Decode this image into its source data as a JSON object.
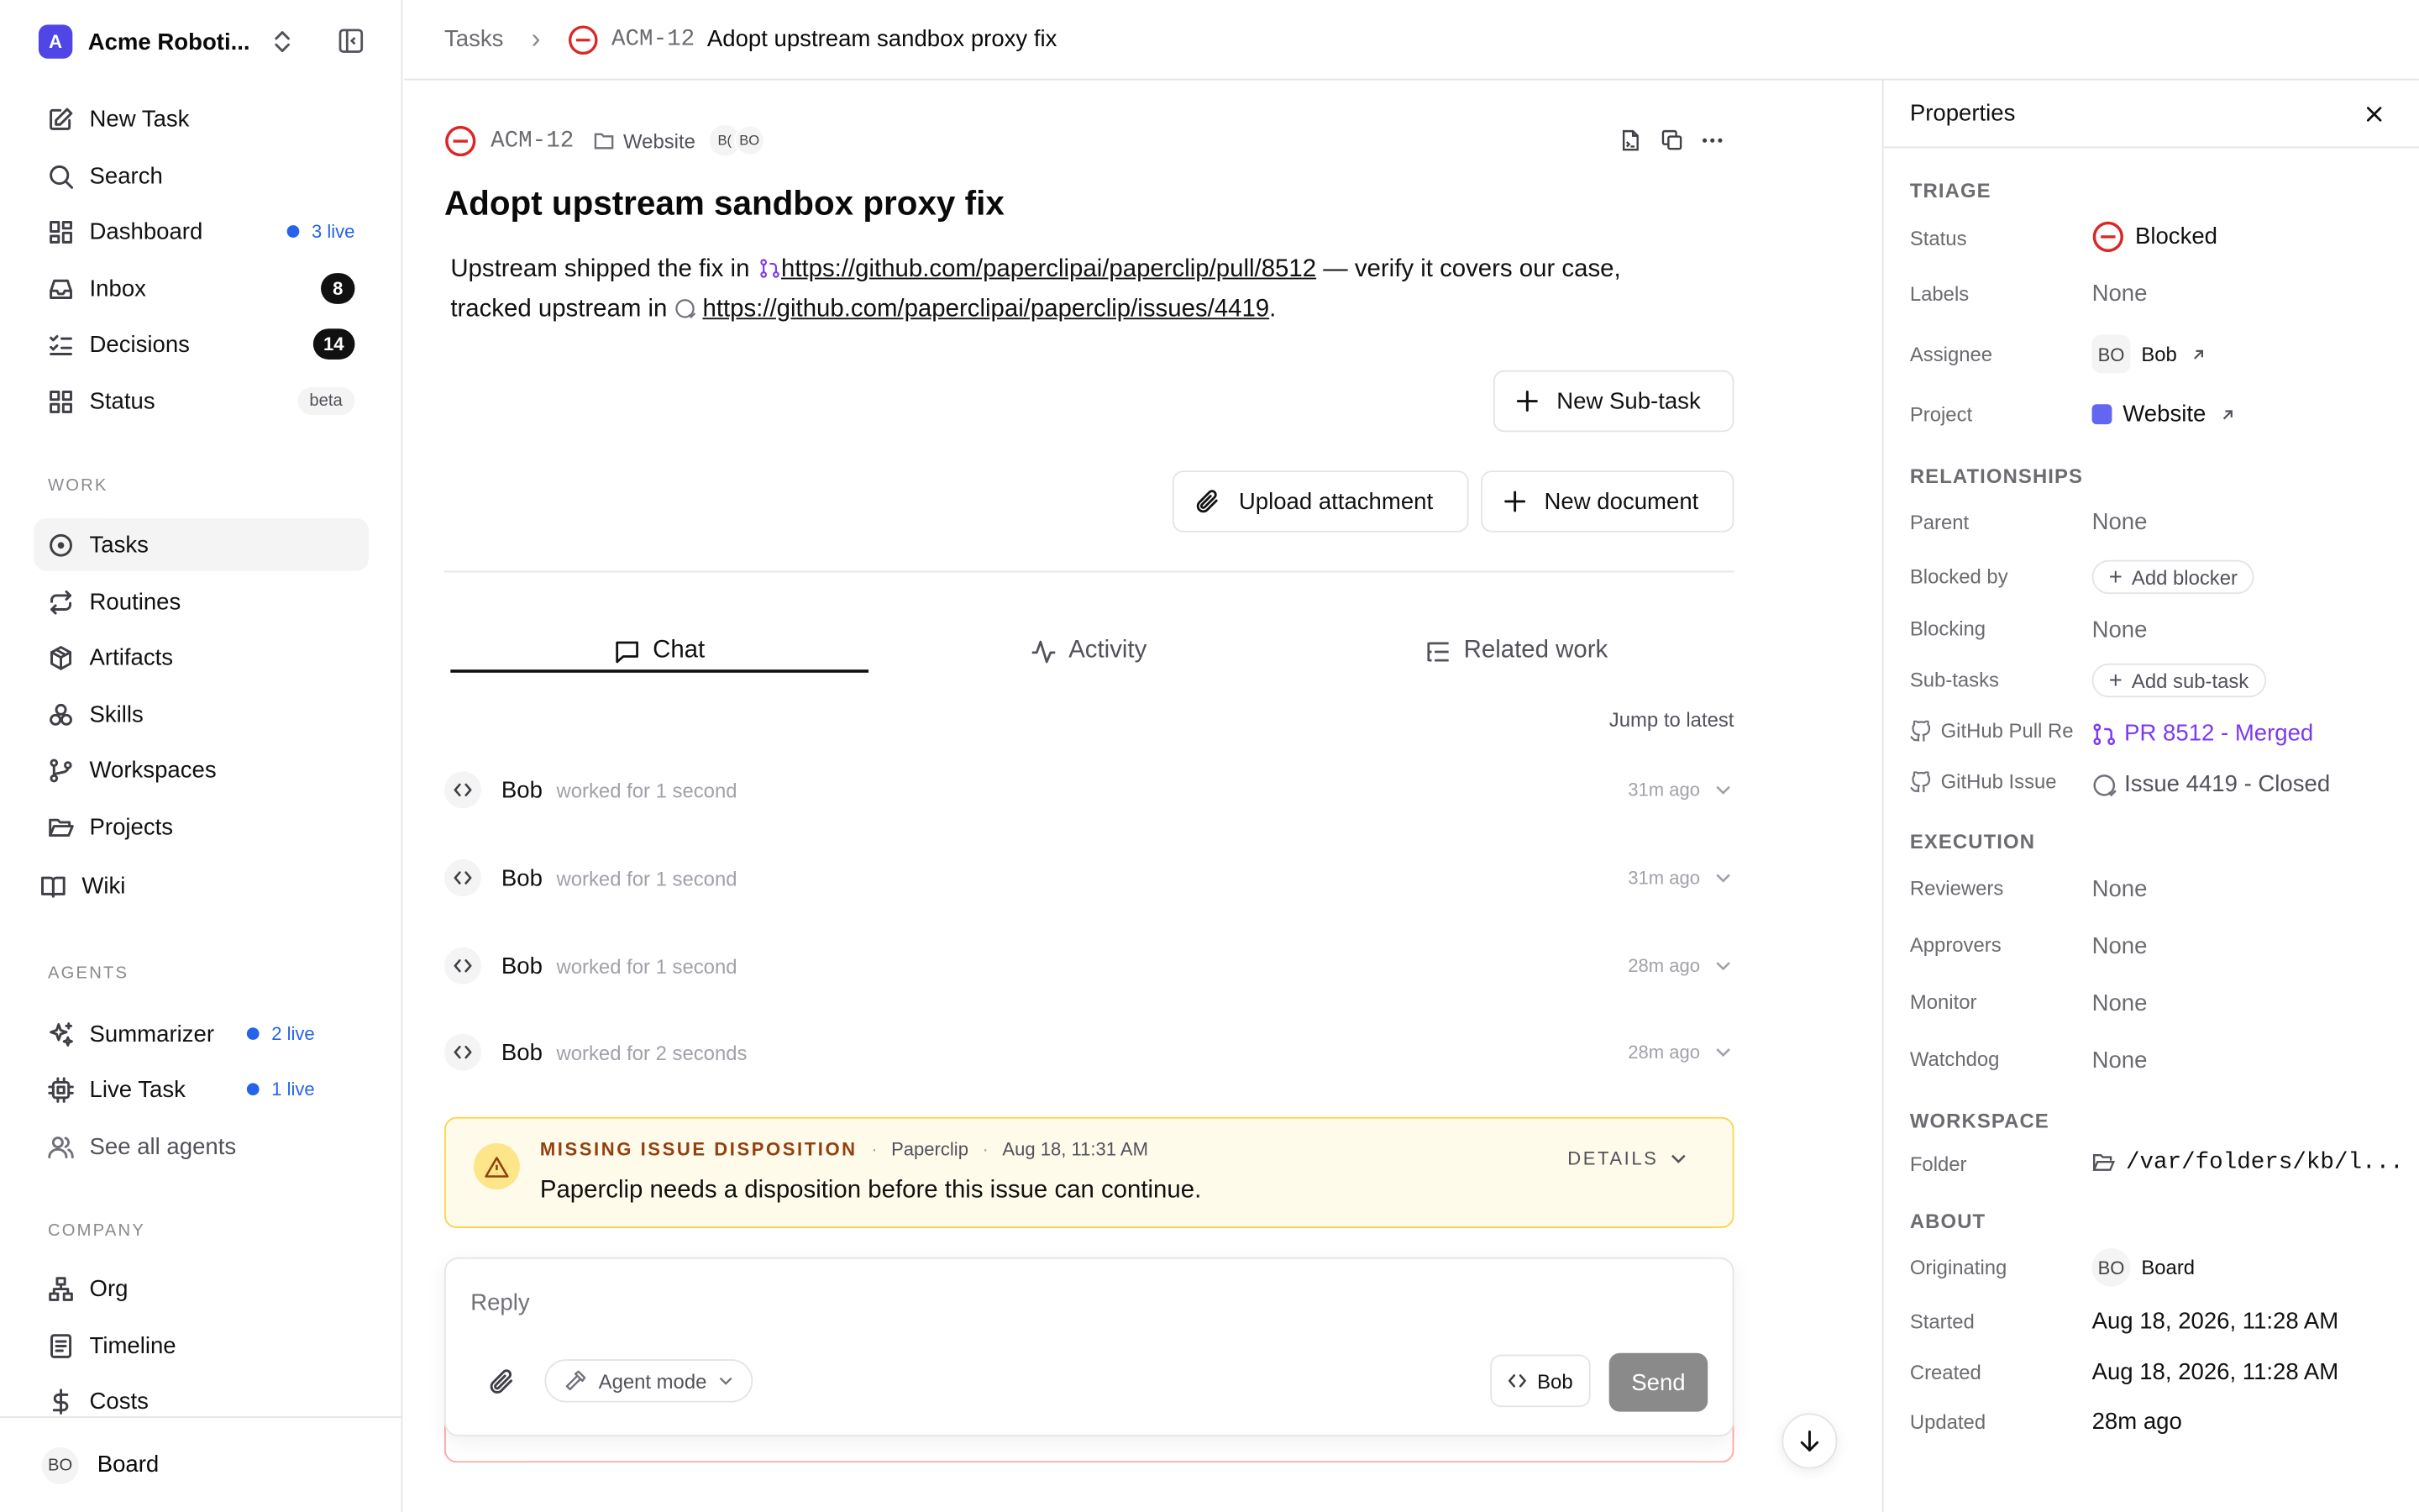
{
  "sidebar": {
    "workspace_initial": "A",
    "workspace_name": "Acme Roboti...",
    "nav": {
      "new_task": "New Task",
      "search": "Search",
      "dashboard": "Dashboard",
      "dashboard_live": "3 live",
      "inbox": "Inbox",
      "inbox_count": "8",
      "decisions": "Decisions",
      "decisions_count": "14",
      "status": "Status",
      "status_badge": "beta"
    },
    "work_label": "WORK",
    "work": {
      "tasks": "Tasks",
      "routines": "Routines",
      "artifacts": "Artifacts",
      "skills": "Skills",
      "workspaces": "Workspaces",
      "projects": "Projects",
      "wiki": "Wiki"
    },
    "agents_label": "AGENTS",
    "agents": {
      "summarizer": "Summarizer",
      "summarizer_live": "2 live",
      "live_task": "Live Task",
      "live_task_live": "1 live",
      "see_all": "See all agents"
    },
    "company_label": "COMPANY",
    "company": {
      "org": "Org",
      "timeline": "Timeline",
      "costs": "Costs"
    },
    "footer": {
      "initials": "BO",
      "name": "Board"
    }
  },
  "breadcrumb": {
    "root": "Tasks",
    "separator": "›",
    "task_id": "ACM-12",
    "task_title": "Adopt upstream sandbox proxy fix"
  },
  "task": {
    "id": "ACM-12",
    "project": "Website",
    "avatar_1": "B(",
    "avatar_2": "BO",
    "title": "Adopt upstream sandbox proxy fix",
    "desc_1": "Upstream shipped the fix in",
    "pr_link": "https://github.com/paperclipai/paperclip/pull/8512",
    "desc_2": "— verify it covers our case,",
    "desc_3": "tracked upstream in",
    "issue_link": "https://github.com/paperclipai/paperclip/issues/4419",
    "desc_end": ".",
    "new_subtask": "New Sub-task",
    "upload_attachment": "Upload attachment",
    "new_document": "New document"
  },
  "tabs": {
    "chat": "Chat",
    "activity": "Activity",
    "related": "Related work"
  },
  "jump_latest": "Jump to latest",
  "runs": [
    {
      "name": "Bob",
      "note": "worked for 1 second",
      "time": "31m ago"
    },
    {
      "name": "Bob",
      "note": "worked for 1 second",
      "time": "31m ago"
    },
    {
      "name": "Bob",
      "note": "worked for 1 second",
      "time": "28m ago"
    },
    {
      "name": "Bob",
      "note": "worked for 2 seconds",
      "time": "28m ago"
    }
  ],
  "alert": {
    "title": "MISSING ISSUE DISPOSITION",
    "sep": "·",
    "source": "Paperclip",
    "time": "Aug 18, 11:31 AM",
    "details": "DETAILS",
    "message": "Paperclip needs a disposition before this issue can continue."
  },
  "composer": {
    "placeholder": "Reply",
    "agent_mode": "Agent mode",
    "agent": "Bob",
    "send": "Send"
  },
  "properties": {
    "title": "Properties",
    "triage": "TRIAGE",
    "status_label": "Status",
    "status_value": "Blocked",
    "labels_label": "Labels",
    "labels_value": "None",
    "assignee_label": "Assignee",
    "assignee_initials": "BO",
    "assignee_value": "Bob",
    "project_label": "Project",
    "project_value": "Website",
    "relationships": "RELATIONSHIPS",
    "parent_label": "Parent",
    "parent_value": "None",
    "blocked_by_label": "Blocked by",
    "add_blocker": "Add blocker",
    "blocking_label": "Blocking",
    "blocking_value": "None",
    "subtasks_label": "Sub-tasks",
    "add_subtask": "Add sub-task",
    "gh_pr_label": "GitHub Pull Re",
    "gh_pr_value": "PR 8512 - Merged",
    "gh_issue_label": "GitHub Issue",
    "gh_issue_value": "Issue 4419 - Closed",
    "execution": "EXECUTION",
    "reviewers_label": "Reviewers",
    "reviewers_value": "None",
    "approvers_label": "Approvers",
    "approvers_value": "None",
    "monitor_label": "Monitor",
    "monitor_value": "None",
    "watchdog_label": "Watchdog",
    "watchdog_value": "None",
    "workspace": "WORKSPACE",
    "folder_label": "Folder",
    "folder_value": "/var/folders/kb/l...",
    "about": "ABOUT",
    "originating_label": "Originating",
    "originating_initials": "BO",
    "originating_value": "Board",
    "started_label": "Started",
    "started_value": "Aug 18, 2026, 11:28 AM",
    "created_label": "Created",
    "created_value": "Aug 18, 2026, 11:28 AM",
    "updated_label": "Updated",
    "updated_value": "28m ago"
  },
  "colors": {
    "accent": "#2563eb",
    "blocked": "#dc2626",
    "merged": "#7c3aed",
    "project_dot": "#6366f1",
    "warning_bg": "#fffbeb",
    "warning_border": "#fcd34d",
    "warning_title": "#92400e"
  }
}
